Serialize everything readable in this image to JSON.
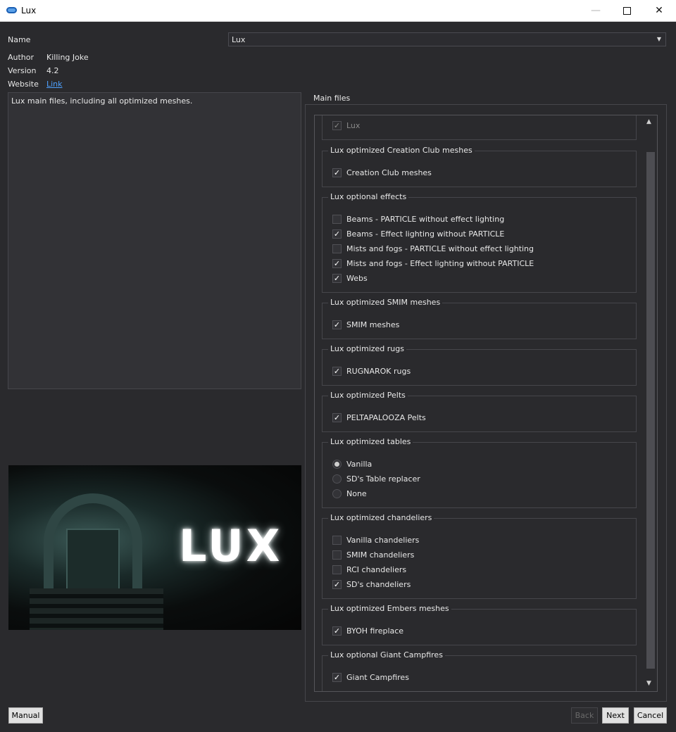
{
  "window": {
    "title": "Lux",
    "minimize": "—",
    "close": "✕"
  },
  "info": {
    "name_label": "Name",
    "name_value": "Lux",
    "author_label": "Author",
    "author_value": "Killing Joke",
    "version_label": "Version",
    "version_value": "4.2",
    "website_label": "Website",
    "website_link": "Link",
    "description": "Lux main files, including all optimized meshes."
  },
  "preview": {
    "logo_text": "LUX"
  },
  "main_group_title": "Main files",
  "groups": [
    {
      "title": "",
      "type": "checkbox",
      "options": [
        {
          "label": "Lux",
          "checked": true,
          "disabled": true
        }
      ]
    },
    {
      "title": "Lux optimized Creation Club meshes",
      "type": "checkbox",
      "options": [
        {
          "label": "Creation Club meshes",
          "checked": true
        }
      ]
    },
    {
      "title": "Lux optional effects",
      "type": "checkbox",
      "options": [
        {
          "label": "Beams - PARTICLE without effect lighting",
          "checked": false
        },
        {
          "label": "Beams - Effect lighting without PARTICLE",
          "checked": true
        },
        {
          "label": "Mists and fogs - PARTICLE without effect lighting",
          "checked": false
        },
        {
          "label": "Mists and fogs - Effect lighting without PARTICLE",
          "checked": true
        },
        {
          "label": "Webs",
          "checked": true
        }
      ]
    },
    {
      "title": "Lux optimized SMIM meshes",
      "type": "checkbox",
      "options": [
        {
          "label": "SMIM meshes",
          "checked": true
        }
      ]
    },
    {
      "title": "Lux optimized rugs",
      "type": "checkbox",
      "options": [
        {
          "label": "RUGNAROK rugs",
          "checked": true
        }
      ]
    },
    {
      "title": "Lux optimized Pelts",
      "type": "checkbox",
      "options": [
        {
          "label": "PELTAPALOOZA Pelts",
          "checked": true
        }
      ]
    },
    {
      "title": "Lux optimized tables",
      "type": "radio",
      "options": [
        {
          "label": "Vanilla",
          "checked": true
        },
        {
          "label": "SD's Table replacer",
          "checked": false
        },
        {
          "label": "None",
          "checked": false
        }
      ]
    },
    {
      "title": "Lux optimized chandeliers",
      "type": "checkbox",
      "options": [
        {
          "label": "Vanilla chandeliers",
          "checked": false
        },
        {
          "label": "SMIM chandeliers",
          "checked": false
        },
        {
          "label": "RCI chandeliers",
          "checked": false
        },
        {
          "label": "SD's chandeliers",
          "checked": true
        }
      ]
    },
    {
      "title": "Lux optimized Embers meshes",
      "type": "checkbox",
      "options": [
        {
          "label": "BYOH fireplace",
          "checked": true
        }
      ]
    },
    {
      "title": "Lux optional Giant Campfires",
      "type": "checkbox",
      "options": [
        {
          "label": "Giant Campfires",
          "checked": true
        }
      ]
    }
  ],
  "buttons": {
    "manual": "Manual",
    "back": "Back",
    "next": "Next",
    "cancel": "Cancel"
  }
}
